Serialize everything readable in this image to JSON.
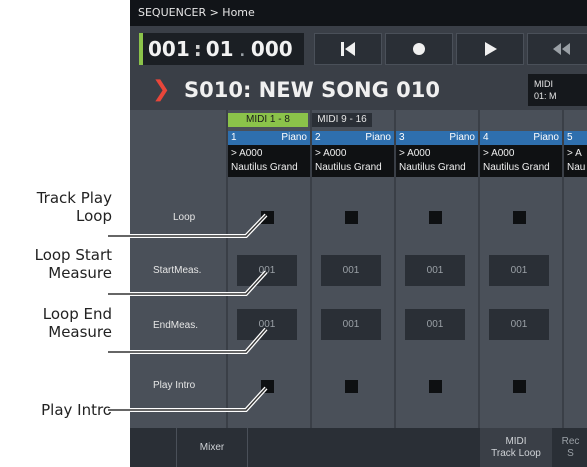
{
  "breadcrumb": "SEQUENCER > Home",
  "locator": {
    "measure": "001",
    "beat": "01",
    "tick": "000"
  },
  "song_title": "S010: NEW SONG 010",
  "midi_box": {
    "line1": "MIDI",
    "line2": "01: M"
  },
  "tabs": {
    "a": "MIDI 1 - 8",
    "b": "MIDI 9 - 16"
  },
  "tracks": [
    {
      "num": "1",
      "name": "Piano",
      "program": "> A000",
      "preset": "Nautilus Grand"
    },
    {
      "num": "2",
      "name": "Piano",
      "program": "> A000",
      "preset": "Nautilus Grand"
    },
    {
      "num": "3",
      "name": "Piano",
      "program": "> A000",
      "preset": "Nautilus Grand"
    },
    {
      "num": "4",
      "name": "Piano",
      "program": "> A000",
      "preset": "Nautilus Grand"
    },
    {
      "num": "5",
      "name": "",
      "program": "> A",
      "preset": "Nau"
    }
  ],
  "rows": {
    "loop": "Loop",
    "start": "StartMeas.",
    "end": "EndMeas.",
    "intro": "Play Intro"
  },
  "start_values": [
    "001",
    "001",
    "001",
    "001"
  ],
  "end_values": [
    "001",
    "001",
    "001",
    "001"
  ],
  "bottom_tabs": {
    "mixer": "Mixer",
    "midi_line1": "MIDI",
    "midi_line2": "Track Loop",
    "rec_line1": "Rec",
    "rec_line2": "S"
  },
  "callouts": {
    "track_play_loop_1": "Track Play",
    "track_play_loop_2": "Loop",
    "loop_start_1": "Loop Start",
    "loop_start_2": "Measure",
    "loop_end_1": "Loop End",
    "loop_end_2": "Measure",
    "play_intro": "Play Intro"
  },
  "colors": {
    "accent_green": "#8bc34a",
    "track_header_blue": "#2e6fae",
    "chevron_red": "#e8463a",
    "panel_gray": "#4a5059"
  }
}
